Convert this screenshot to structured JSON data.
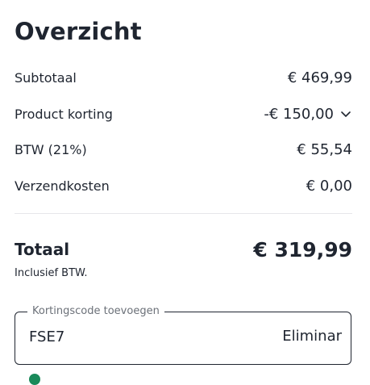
{
  "title": "Overzicht",
  "summary": {
    "subtotal": {
      "label": "Subtotaal",
      "value": "€ 469,99"
    },
    "discount": {
      "label": "Product korting",
      "value": "-€ 150,00"
    },
    "vat": {
      "label": "BTW (21%)",
      "value": "€ 55,54"
    },
    "shipping": {
      "label": "Verzendkosten",
      "value": "€ 0,00"
    }
  },
  "total": {
    "label": "Totaal",
    "value": "€ 319,99",
    "note": "Inclusief BTW."
  },
  "coupon": {
    "legend": "Kortingscode toevoegen",
    "value": "FSE7",
    "remove_label": "Eliminar"
  },
  "colors": {
    "text": "#1f2530",
    "muted": "#6b7078",
    "success": "#1a8a5a",
    "divider": "#e6e7ea"
  }
}
